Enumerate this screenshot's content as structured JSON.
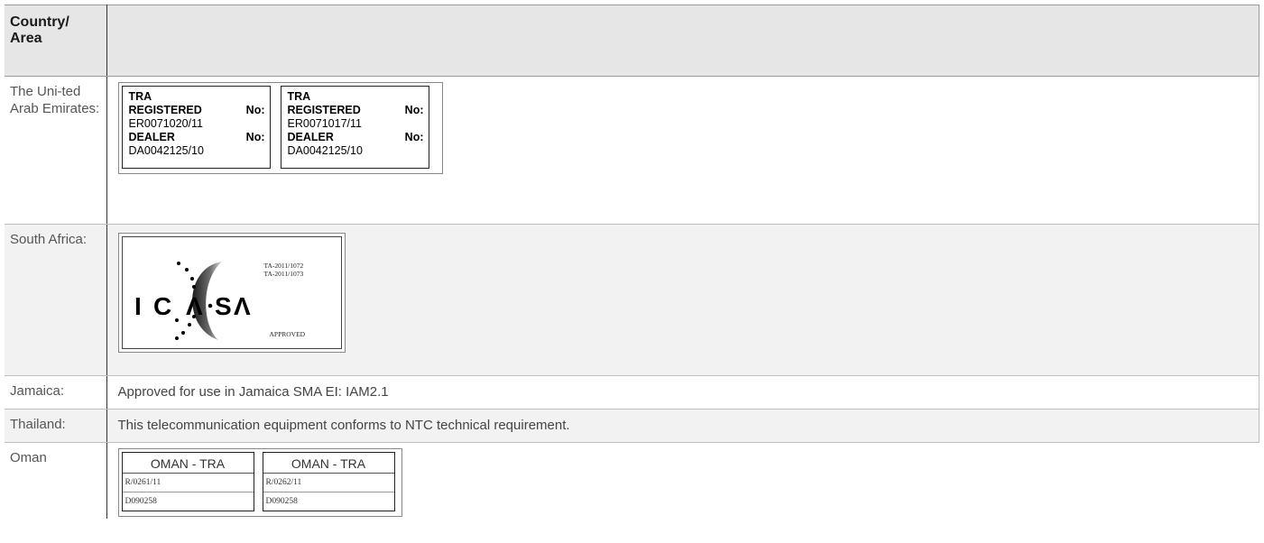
{
  "header": {
    "country_label": "Country/ Area",
    "value_label": ""
  },
  "rows": {
    "uae": {
      "country": "The Uni-ted Arab Emirates:",
      "labels": [
        {
          "tra": "TRA",
          "registered": "REGISTERED",
          "no": "No:",
          "reg_number": "ER0071020/11",
          "dealer": "DEALER",
          "dealer_number": "DA0042125/10"
        },
        {
          "tra": "TRA",
          "registered": "REGISTERED",
          "no": "No:",
          "reg_number": "ER0071017/11",
          "dealer": "DEALER",
          "dealer_number": "DA0042125/10"
        }
      ]
    },
    "south_africa": {
      "country": "South Africa:",
      "logo_text": "ICASA",
      "codes": [
        "TA-2011/1072",
        "TA-2011/1073"
      ],
      "approved": "APPROVED"
    },
    "jamaica": {
      "country": "Jamaica:",
      "text": "Approved for use in Jamaica SMA EI: IAM2.1"
    },
    "thailand": {
      "country": "Thailand:",
      "text": "This telecommunication equipment conforms to NTC technical requirement."
    },
    "oman": {
      "country": "Oman",
      "labels": [
        {
          "title": "OMAN - TRA",
          "reg": "R/0261/11",
          "dealer": "D090258"
        },
        {
          "title": "OMAN - TRA",
          "reg": "R/0262/11",
          "dealer": "D090258"
        }
      ]
    }
  }
}
